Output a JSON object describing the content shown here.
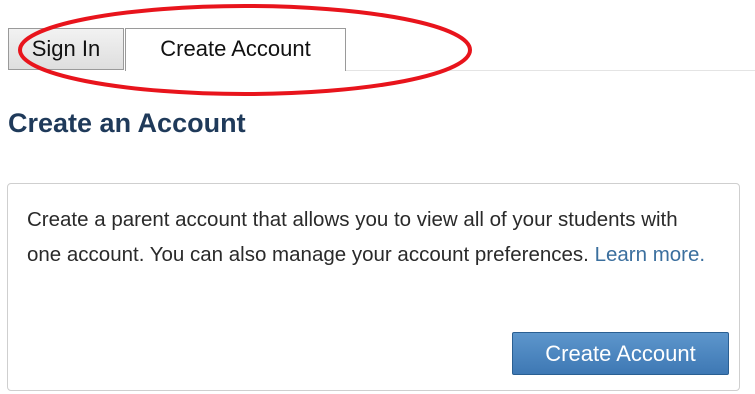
{
  "tabs": {
    "sign_in": "Sign In",
    "create_account": "Create Account",
    "active": "Create Account"
  },
  "heading": "Create an Account",
  "panel": {
    "description": "Create a parent account that allows you to view all of your students with one account. You can also manage your account preferences.",
    "learn_more": "Learn more.",
    "button_label": "Create Account"
  },
  "colors": {
    "heading": "#1f3a5a",
    "link": "#3b6f9e",
    "button": "#3e78b4",
    "annotation_ellipse": "#e8141c"
  }
}
